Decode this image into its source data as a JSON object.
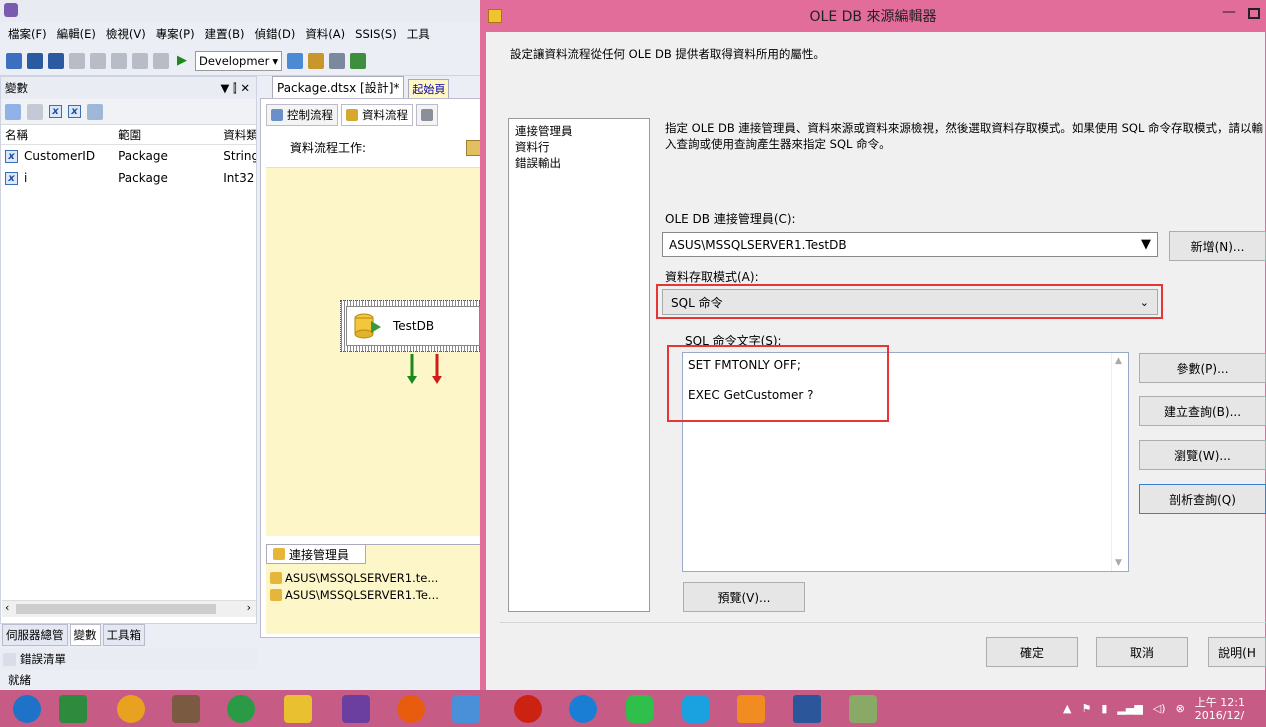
{
  "vs": {
    "menu": [
      "檔案(F)",
      "編輯(E)",
      "檢視(V)",
      "專案(P)",
      "建置(B)",
      "偵錯(D)",
      "資料(A)",
      "SSIS(S)",
      "工具"
    ],
    "config_dropdown": "Developmer",
    "variables_panel": {
      "title": "變數",
      "pin": "▼ ⫿ ✕",
      "columns": [
        "名稱",
        "範圍",
        "資料類"
      ],
      "rows": [
        {
          "name": "CustomerID",
          "scope": "Package",
          "type": "String"
        },
        {
          "name": "i",
          "scope": "Package",
          "type": "Int32"
        }
      ]
    },
    "bottom_tabs": [
      "伺服器總管",
      "變數",
      "工具箱"
    ],
    "error_list": "錯誤清單",
    "status": "就緒",
    "doc_tab": "Package.dtsx [設計]*",
    "doc_tab2": "起始頁",
    "designer_tabs": [
      "控制流程",
      "資料流程"
    ],
    "dataflow_task_label": "資料流程工作:",
    "component_name": "TestDB",
    "conn_manager_tab": "連接管理員",
    "connections": [
      "ASUS\\MSSQLSERVER1.te...",
      "ASUS\\MSSQLSERVER1.Te..."
    ]
  },
  "dialog": {
    "title": "OLE DB 來源編輯器",
    "description": "設定讓資料流程從任何 OLE DB 提供者取得資料所用的屬性。",
    "nav": [
      "連接管理員",
      "資料行",
      "錯誤輸出"
    ],
    "instructions": "指定 OLE DB 連接管理員、資料來源或資料來源檢視，然後選取資料存取模式。如果使用 SQL 命令存取模式，請以輸入查詢或使用查詢產生器來指定 SQL 命令。",
    "conn_label": "OLE DB 連接管理員(C):",
    "conn_value": "ASUS\\MSSQLSERVER1.TestDB",
    "new_button": "新增(N)...",
    "mode_label": "資料存取模式(A):",
    "mode_value": "SQL 命令",
    "sql_label": "SQL 命令文字(S):",
    "sql_lines": [
      "SET FMTONLY OFF;",
      "EXEC GetCustomer ?"
    ],
    "param_button": "參數(P)...",
    "build_button": "建立查詢(B)...",
    "browse_button": "瀏覽(W)...",
    "parse_button": "剖析查詢(Q)",
    "preview_button": "預覽(V)...",
    "ok_button": "確定",
    "cancel_button": "取消",
    "help_button": "說明(H"
  },
  "taskbar": {
    "clock_time": "上午 12:1",
    "clock_date": "2016/12/",
    "icon_colors": [
      "#1e73c8",
      "#2e8b3e",
      "#e8a220",
      "#7a5a40",
      "#2b9a45",
      "#e8c030",
      "#6b3fa0",
      "#e85c0d",
      "#4a90d9",
      "#c21",
      "#1a7fd4",
      "#2ec04a",
      "#1aa1e0",
      "#f08c20",
      "#2b579a",
      "#8a6"
    ]
  },
  "colors": {
    "accent": "#e26c9a",
    "taskbar": "#c65c85",
    "highlight": "#e53535"
  }
}
